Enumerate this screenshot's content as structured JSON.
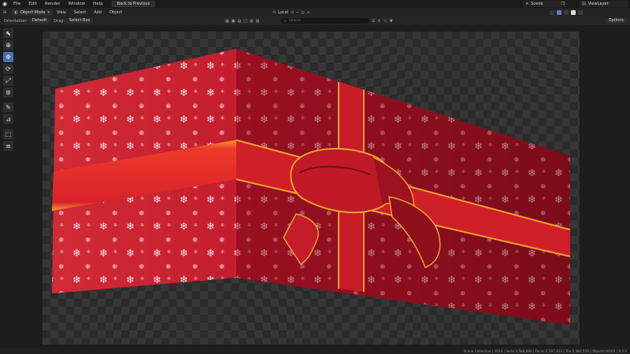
{
  "topbar": {
    "menu": [
      "File",
      "Edit",
      "Render",
      "Window",
      "Help"
    ],
    "back_button": "Back to Previous",
    "scene_label": "Scene",
    "view_layer_label": "ViewLayer"
  },
  "header": {
    "mode": "Object Mode",
    "menu": [
      "View",
      "Select",
      "Add",
      "Object"
    ],
    "transform_space": "Local"
  },
  "tool_settings": {
    "orientation_label": "Orientation:",
    "orientation_value": "Default",
    "drag_label": "Drag:",
    "drag_value": "Select Box",
    "search_placeholder": "Search",
    "options_label": "Options"
  },
  "toolbar": {
    "tools": [
      "cursor-tool",
      "select-tool",
      "move-tool",
      "rotate-tool",
      "scale-tool",
      "transform-tool",
      "annotate-tool",
      "measure-tool",
      "add-cube-tool",
      "extrude-tool"
    ],
    "active": "move-tool"
  },
  "status": {
    "text": "Scene Collection | 2024 | Verts:3,548,690 | Faces:2,597,422 | Tris:5,083,576 | Objects:4/165 | 4.0.0"
  },
  "colors": {
    "accent": "#4772b3",
    "paper_red": "#c4202e",
    "ribbon_red": "#e8302a",
    "ribbon_gold": "#f0a030"
  }
}
